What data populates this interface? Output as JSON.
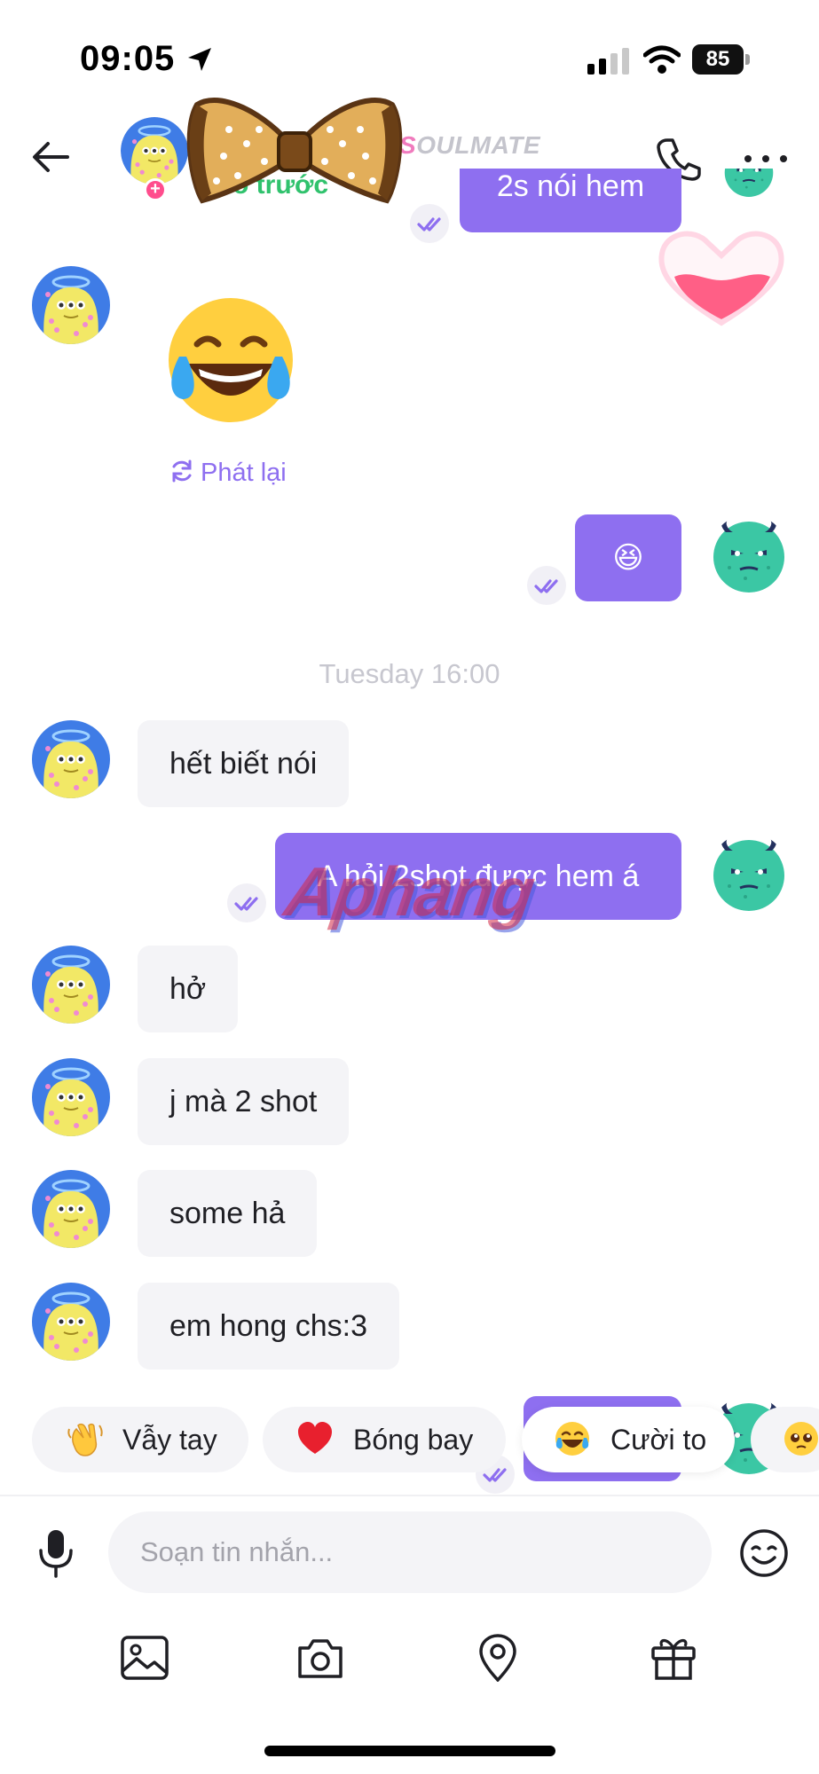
{
  "status_bar": {
    "time": "09:05",
    "battery": "85"
  },
  "header": {
    "subtitle": "o trước",
    "brand_prefix": "S",
    "brand_rest": "OULMATE"
  },
  "messages": {
    "partial_top": "2s nói hem",
    "replay_label": "Phát lại",
    "out_emoji": "😆",
    "timestamp": "Tuesday 16:00",
    "m1": "hết biết nói",
    "m2": "A hỏi 2shot được hem á",
    "m3": "hở",
    "m4": "j mà 2 shot",
    "m5": "some hả",
    "m6": "em hong chs:3"
  },
  "quick_reactions": [
    {
      "label": "Vẫy tay",
      "emoji": "👋"
    },
    {
      "label": "Bóng bay",
      "emoji": "❤️"
    },
    {
      "label": "Cười to",
      "emoji": "😂"
    },
    {
      "label": "",
      "emoji": "🥺"
    }
  ],
  "composer": {
    "placeholder": "Soạn tin nhắn..."
  },
  "watermark": "Aphang",
  "colors": {
    "accent": "#8e6ff0",
    "incoming_bubble": "#f4f4f7",
    "online_green": "#30c26d",
    "badge_pink": "#ff4d8d"
  },
  "icons": [
    "back-arrow-icon",
    "phone-icon",
    "more-icon",
    "mic-icon",
    "emoji-icon",
    "image-icon",
    "camera-icon",
    "location-pin-icon",
    "gift-icon",
    "read-check-icon",
    "replay-icon"
  ]
}
